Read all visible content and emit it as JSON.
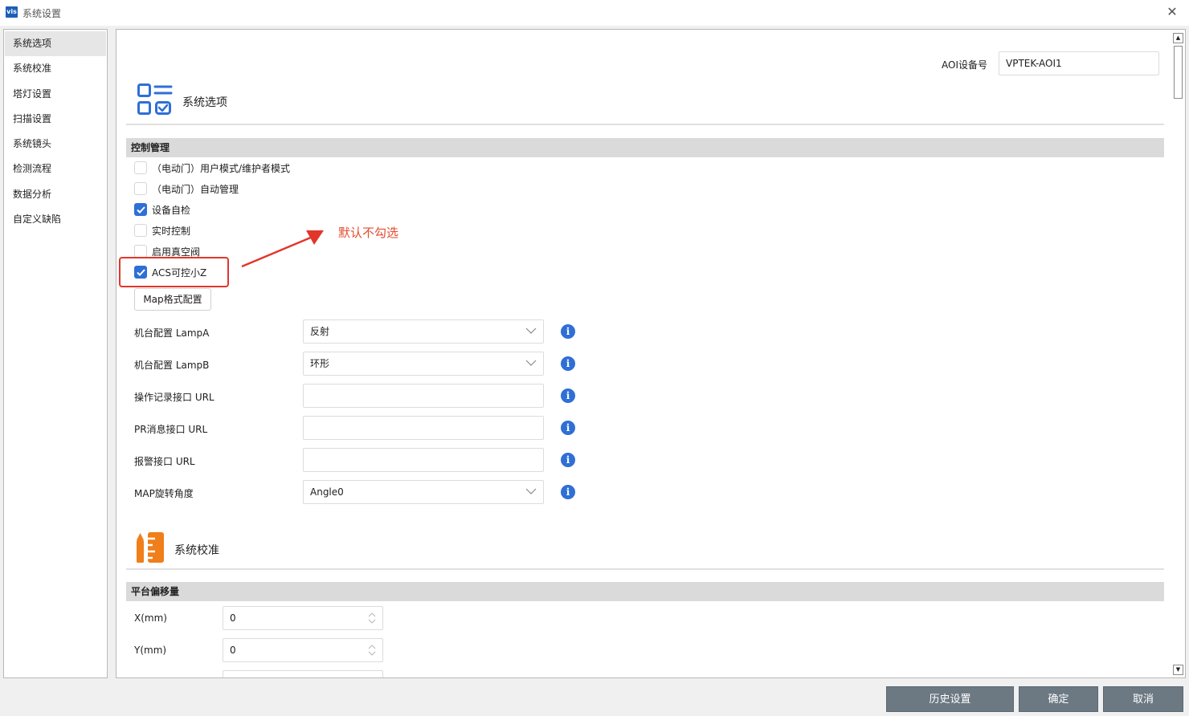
{
  "window": {
    "logo_text": "vis",
    "title": "系统设置"
  },
  "sidebar": {
    "items": [
      {
        "label": "系统选项"
      },
      {
        "label": "系统校准"
      },
      {
        "label": "塔灯设置"
      },
      {
        "label": "扫描设置"
      },
      {
        "label": "系统镜头"
      },
      {
        "label": "检测流程"
      },
      {
        "label": "数据分析"
      },
      {
        "label": "自定义缺陷"
      }
    ],
    "active_index": 0
  },
  "aoi": {
    "label": "AOI设备号",
    "value": "VPTEK-AOI1"
  },
  "section_options": {
    "title": "系统选项",
    "icon": "checklist-icon",
    "group": "控制管理"
  },
  "checkboxes": [
    {
      "label": "（电动门）用户模式/维护者模式",
      "checked": false
    },
    {
      "label": "（电动门）自动管理",
      "checked": false
    },
    {
      "label": "设备自检",
      "checked": true
    },
    {
      "label": "实时控制",
      "checked": false
    },
    {
      "label": "启用真空阀",
      "checked": false
    },
    {
      "label": "ACS可控小Z",
      "checked": true
    }
  ],
  "annotation": "默认不勾选",
  "map_button": "Map格式配置",
  "form": [
    {
      "label": "机台配置 LampA",
      "value": "反射",
      "type": "select"
    },
    {
      "label": "机台配置 LampB",
      "value": "环形",
      "type": "select"
    },
    {
      "label": "操作记录接口 URL",
      "value": "",
      "type": "text"
    },
    {
      "label": "PR消息接口 URL",
      "value": "",
      "type": "text"
    },
    {
      "label": "报警接口 URL",
      "value": "",
      "type": "text"
    },
    {
      "label": "MAP旋转角度",
      "value": "Angle0",
      "type": "select"
    }
  ],
  "section_calib": {
    "title": "系统校准",
    "icon": "ruler-pencil-icon",
    "group": "平台偏移量"
  },
  "offset_fields": [
    {
      "label": "X(mm)",
      "value": "0"
    },
    {
      "label": "Y(mm)",
      "value": "0"
    }
  ],
  "footer": {
    "history": "历史设置",
    "ok": "确定",
    "cancel": "取消"
  },
  "colors": {
    "accent": "#2f6fd6",
    "footer_button": "#6c7983",
    "highlight": "#e2362b",
    "calib_icon": "#f07e1a"
  }
}
